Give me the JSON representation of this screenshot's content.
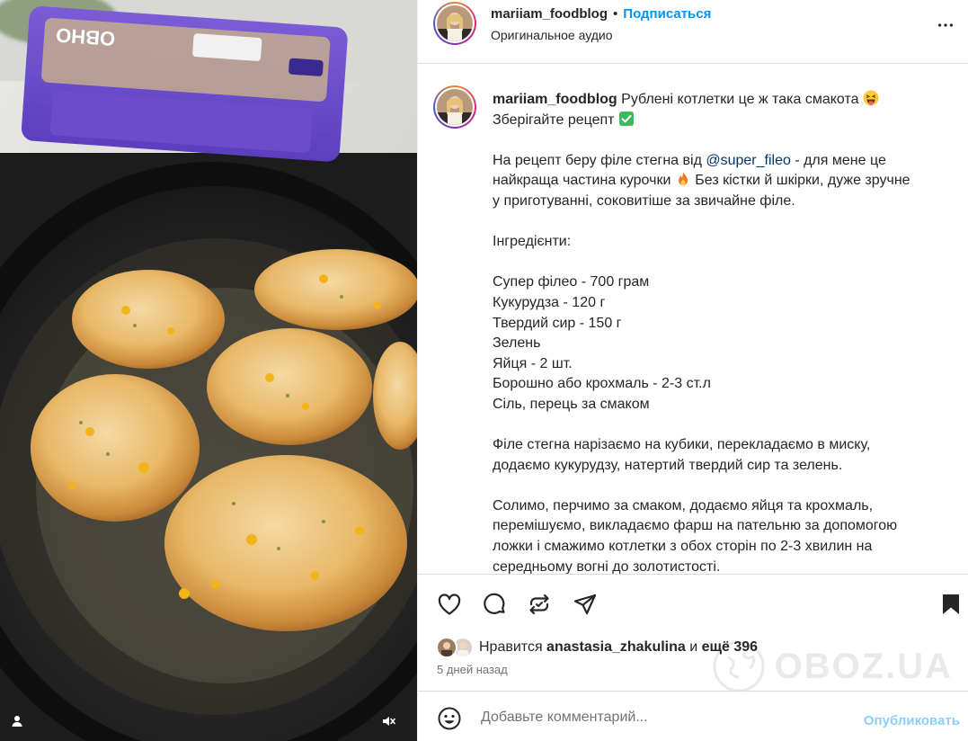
{
  "media": {
    "user_icon": "person-icon",
    "mute_icon": "speaker-muted-icon"
  },
  "header": {
    "username": "mariiam_foodblog",
    "separator": "•",
    "follow_label": "Подписаться",
    "audio_label": "Оригинальное аудио",
    "more_icon": "more-horizontal-icon"
  },
  "caption": {
    "username": "mariiam_foodblog",
    "line1_text": "Рублені котлетки це ж така смакота",
    "line1_emoji": "squinting-tongue-emoji",
    "line2_text": "Зберігайте рецепт",
    "line2_emoji": "check-mark-emoji",
    "p2_line1_before": "На рецепт беру філе стегна від ",
    "p2_mention": "@super_fileo",
    "p2_line1_after": " - для мене це",
    "p2_line2": "найкраща частина курочки",
    "p2_line2_emoji": "fire-emoji",
    "p2_line2_after": "  Без кістки й шкірки, дуже зручне",
    "p2_line3": "у приготуванні, соковитіше за звичайне філе.",
    "ingredients_title": "Інгредієнти:",
    "ingredients": [
      "Супер філео - 700 грам",
      "Кукурудза - 120 г",
      "Твердий сир - 150 г",
      "Зелень",
      "Яйця - 2 шт.",
      "Борошно або крохмаль - 2-3 ст.л",
      "Сіль, перець за смаком"
    ],
    "step1": [
      "Філе стегна нарізаємо на кубики, перекладаємо в миску,",
      "додаємо кукурудзу, натертий твердий сир та зелень."
    ],
    "step2": [
      "Солимо, перчимо за смаком, додаємо яйця та крохмаль,",
      "перемішуємо, викладаємо фарш на пательню за допомогою",
      "ложки і смажимо котлетки з обох сторін по 2-3 хвилин на",
      "середньому вогні до золотистості."
    ]
  },
  "actions": {
    "like_icon": "heart-icon",
    "comment_icon": "comment-bubble-icon",
    "repost_icon": "repost-icon",
    "share_icon": "paper-plane-icon",
    "save_icon": "bookmark-icon"
  },
  "likes": {
    "prefix": "Нравится ",
    "user": "anastasia_zhakulina",
    "middle": " и ",
    "more": "ещё 396"
  },
  "date": "5 дней назад",
  "watermark": "OBOZ.UA",
  "comment": {
    "emoji_icon": "smiley-icon",
    "placeholder": "Добавьте комментарий...",
    "publish_label": "Опубликовать"
  },
  "colors": {
    "link_blue": "#0095f6",
    "mention_blue": "#00376b",
    "muted_text": "#737373",
    "divider": "#dbdbdb"
  }
}
